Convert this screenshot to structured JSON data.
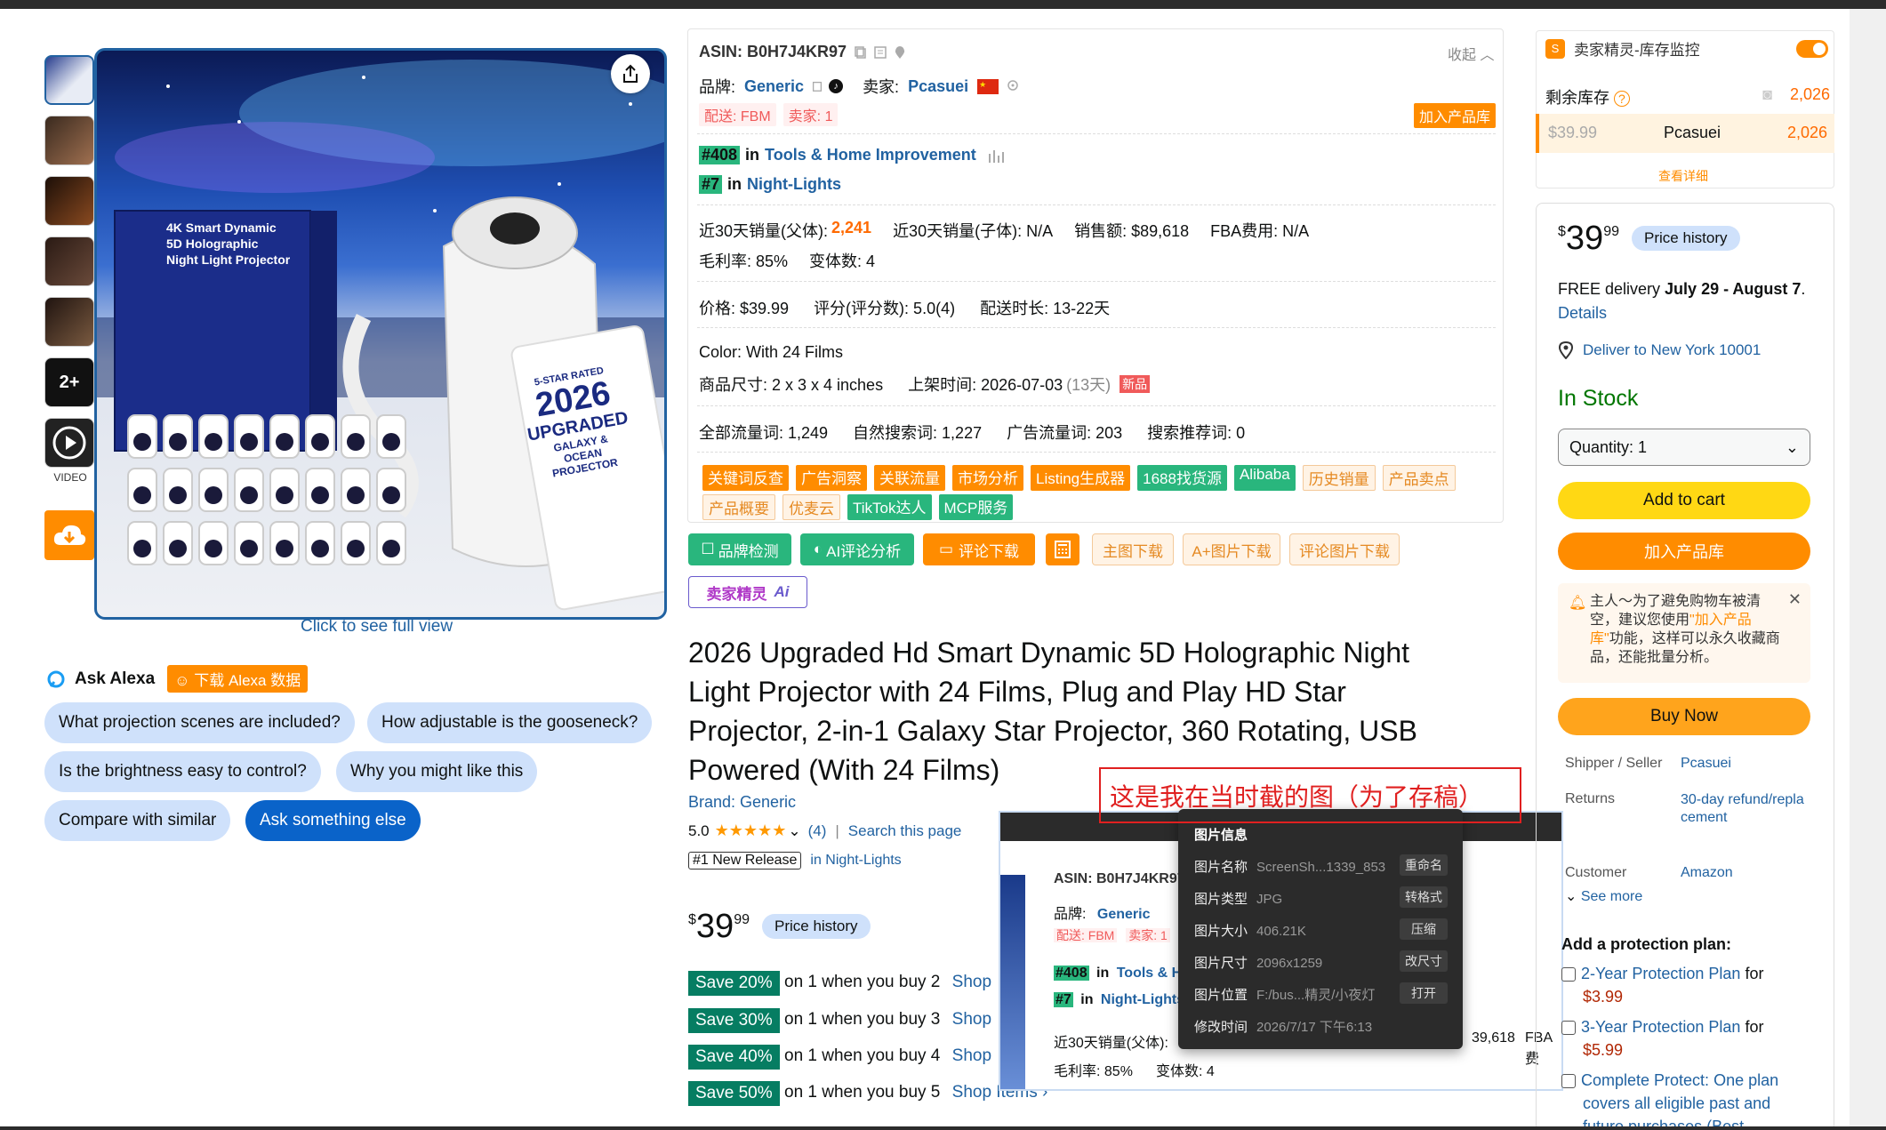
{
  "thumbs": {
    "more_label": "2+",
    "video_label": "VIDEO"
  },
  "image": {
    "click_full_view": "Click to see full view",
    "box": {
      "l1": "4K Smart Dynamic",
      "l2": "5D Holographic",
      "l3": "Night Light Projector"
    },
    "tag": {
      "rated": "5-STAR RATED",
      "year": "2026",
      "upgraded": "UPGRADED",
      "sub1": "GALAXY &",
      "sub2": "OCEAN",
      "sub3": "PROJECTOR"
    }
  },
  "alexa": {
    "label": "Ask Alexa",
    "download": "下载 Alexa 数据",
    "chips": [
      "What projection scenes are included?",
      "How adjustable is the gooseneck?",
      "Is the brightness easy to control?",
      "Why you might like this",
      "Compare with similar",
      "Ask something else"
    ]
  },
  "plugin": {
    "asin": "ASIN: B0H7J4KR97",
    "collapse": "收起",
    "brand_label": "品牌:",
    "brand_value": "Generic",
    "seller_label": "卖家:",
    "seller_value": "Pcasuei",
    "ship_fbm": "配送: FBM",
    "seller_count": "卖家: 1",
    "add_lib": "加入产品库",
    "rank1_badge": "#408",
    "rank1_in": "in",
    "rank1_cat": "Tools & Home Improvement",
    "rank2_badge": "#7",
    "rank2_in": "in",
    "rank2_cat": "Night-Lights",
    "sales_parent_label": "近30天销量(父体):",
    "sales_parent_value": "2,241",
    "sales_child": "近30天销量(子体): N/A",
    "revenue": "销售额: $89,618",
    "fba": "FBA费用:  N/A",
    "margin": "毛利率: 85%",
    "variants": "变体数: 4",
    "price": "价格: $39.99",
    "rating": "评分(评分数):  5.0(4)",
    "ship_time": "配送时长: 13-22天",
    "color": "Color:  With 24 Films",
    "size": "商品尺寸: 2 x 3 x 4 inches",
    "listed": "上架时间: 2026-07-03",
    "listed_days": "(13天)",
    "new_badge": "新品",
    "traffic_all": "全部流量词: 1,249",
    "traffic_organic": "自然搜索词: 1,227",
    "traffic_ads": "广告流量词: 203",
    "traffic_rec": "搜索推荐词: 0",
    "tags_row1": [
      {
        "t": "关键词反查",
        "c": "o"
      },
      {
        "t": "广告洞察",
        "c": "o"
      },
      {
        "t": "关联流量",
        "c": "o"
      },
      {
        "t": "市场分析",
        "c": "o"
      },
      {
        "t": "Listing生成器",
        "c": "o"
      },
      {
        "t": "1688找货源",
        "c": "g"
      },
      {
        "t": "Alibaba",
        "c": "g"
      },
      {
        "t": "历史销量",
        "c": "l"
      },
      {
        "t": "产品卖点",
        "c": "l"
      }
    ],
    "tags_row2": [
      {
        "t": "产品概要",
        "c": "l"
      },
      {
        "t": "优麦云",
        "c": "l"
      },
      {
        "t": "TikTok达人",
        "c": "g"
      },
      {
        "t": "MCP服务",
        "c": "g"
      }
    ],
    "btn_brand": "品牌检测",
    "btn_ai": "AI评论分析",
    "btn_review": "评论下载",
    "btn_main_img": "主图下载",
    "btn_aplus": "A+图片下载",
    "btn_review_img": "评论图片下载",
    "ai_logo": "卖家精灵",
    "ai_mark": "Ai"
  },
  "product": {
    "title": "2026 Upgraded Hd Smart Dynamic 5D Holographic Night Light Projector with 24 Films, Plug and Play HD Star Projector, 2-in-1 Galaxy Star Projector, 360 Rotating, USB Powered (With 24 Films)",
    "brand": "Brand: Generic",
    "rating": "5.0",
    "stars": "★★★★★",
    "reviews": "(4)",
    "search_page": "Search this page",
    "new_release": "#1 New Release",
    "new_release_cat": "in Night-Lights",
    "price_sym": "$",
    "price_whole": "39",
    "price_frac": "99",
    "price_history": "Price history",
    "saves": [
      {
        "badge": "Save 20%",
        "text": "on 1 when you buy 2",
        "link": "Shop"
      },
      {
        "badge": "Save 30%",
        "text": "on 1 when you buy 3",
        "link": "Shop"
      },
      {
        "badge": "Save 40%",
        "text": "on 1 when you buy 4",
        "link": "Shop"
      },
      {
        "badge": "Save 50%",
        "text": "on 1 when you buy 5",
        "link": "Shop Items ›"
      }
    ]
  },
  "annotation": "这是我在当时截的图（为了存稿）",
  "popup": {
    "title": "图片信息",
    "rows": [
      {
        "label": "图片名称",
        "value": "ScreenSh...1339_853",
        "action": "重命名"
      },
      {
        "label": "图片类型",
        "value": "JPG",
        "action": "转格式"
      },
      {
        "label": "图片大小",
        "value": "406.21K",
        "action": "压缩"
      },
      {
        "label": "图片尺寸",
        "value": "2096x1259",
        "action": "改尺寸"
      },
      {
        "label": "图片位置",
        "value": "F:/bus...精灵/小夜灯",
        "action": "打开"
      },
      {
        "label": "修改时间",
        "value": "2026/7/17 下午6:13",
        "action": ""
      }
    ],
    "bg_asin": "ASIN: B0H7J4KR97",
    "bg_brand_label": "品牌:",
    "bg_brand": "Generic",
    "bg_fbm": "配送: FBM",
    "bg_seller": "卖家: 1",
    "bg_rank1": "#408",
    "bg_rank1_in": "in",
    "bg_rank1_cat": "Tools & H",
    "bg_rank2": "#7",
    "bg_rank2_in": "in",
    "bg_rank2_cat": "Night-Lights",
    "bg_sales": "近30天销量(父体):",
    "bg_revenue": "39,618",
    "bg_fba": "FBA费",
    "bg_margin": "毛利率: 85%",
    "bg_variants": "变体数: 4"
  },
  "inventory": {
    "title": "卖家精灵-库存监控",
    "remaining_label": "剩余库存",
    "remaining_value": "2,026",
    "row_price": "$39.99",
    "row_seller": "Pcasuei",
    "row_qty": "2,026",
    "view_detail": "查看详细"
  },
  "buybox": {
    "price_sym": "$",
    "price_whole": "39",
    "price_frac": "99",
    "price_history": "Price history",
    "delivery_prefix": "FREE delivery ",
    "delivery_dates": "July 29 - August 7",
    "delivery_dot": ". ",
    "details": "Details",
    "deliver_to": "Deliver to New York 10001",
    "stock": "In Stock",
    "quantity": "Quantity: 1",
    "add_cart": "Add to cart",
    "add_lib": "加入产品库",
    "notice_a": "主人～为了避免购物车被清空，建议您使用",
    "notice_link": "\"加入产品库\"",
    "notice_b": "功能，这样可以永久收藏商品，还能批量分析。",
    "buy_now": "Buy Now",
    "shipper_label": "Shipper / Seller",
    "shipper_value": "Pcasuei",
    "returns_label": "Returns",
    "returns_value": "30-day refund/replacement",
    "customer_label": "Customer",
    "customer_value": "Amazon",
    "see_more": "See more",
    "protection_title": "Add a protection plan:",
    "plans": [
      {
        "name": "2-Year Protection Plan",
        "for": " for",
        "price": "$3.99"
      },
      {
        "name": "3-Year Protection Plan",
        "for": " for",
        "price": "$5.99"
      }
    ],
    "complete_protect_a": "Complete Protect: One plan",
    "complete_protect_b": "covers all eligible past and",
    "complete_protect_c": "future purchases (Best"
  },
  "colors": {
    "link": "#2162a1",
    "orange": "#ff8c00",
    "green": "#29b67d",
    "yellow": "#ffd814",
    "buy": "#ffa41c",
    "stock": "#007600"
  }
}
